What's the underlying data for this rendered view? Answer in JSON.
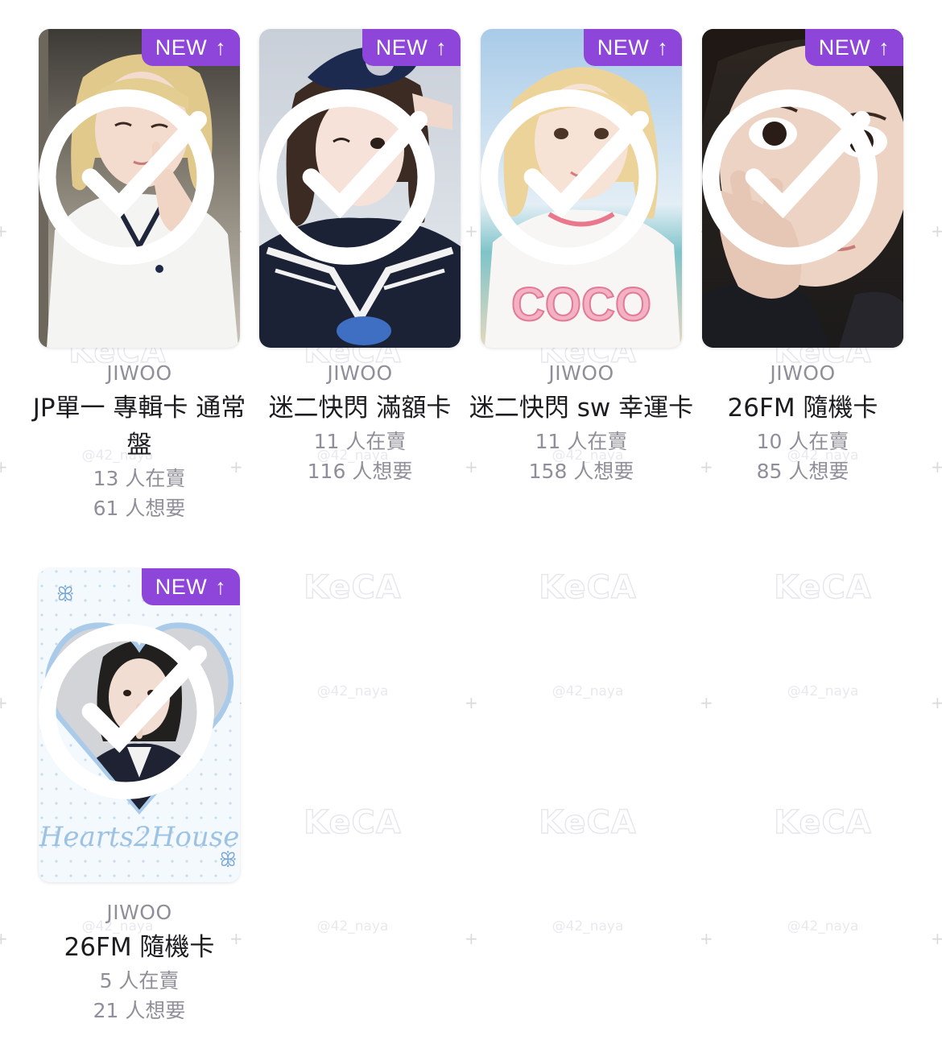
{
  "watermark": {
    "logo": "KeCA",
    "handle": "@42_naya"
  },
  "colors": {
    "badge": "#8d46d9",
    "artist_text": "#8f8f99",
    "name_text": "#1c1c1f"
  },
  "cards": [
    {
      "badge": "NEW",
      "badge_icon": "arrow-up-icon",
      "artist": "JIWOO",
      "name": "JP單一 專輯卡 通常盤",
      "sellers": "13 人在賣",
      "wanted": "61 人想要"
    },
    {
      "badge": "NEW",
      "badge_icon": "arrow-up-icon",
      "artist": "JIWOO",
      "name": "迷二快閃 滿額卡",
      "sellers": "11 人在賣",
      "wanted": "116 人想要"
    },
    {
      "badge": "NEW",
      "badge_icon": "arrow-up-icon",
      "artist": "JIWOO",
      "name": "迷二快閃 sw 幸運卡",
      "sellers": "11 人在賣",
      "wanted": "158 人想要"
    },
    {
      "badge": "NEW",
      "badge_icon": "arrow-up-icon",
      "artist": "JIWOO",
      "name": "26FM 隨機卡",
      "sellers": "10 人在賣",
      "wanted": "85 人想要"
    },
    {
      "badge": "NEW",
      "badge_icon": "arrow-up-icon",
      "artist": "JIWOO",
      "name": "26FM 隨機卡",
      "sellers": "5 人在賣",
      "wanted": "21 人想要",
      "card_art_text": "Hearts2House"
    }
  ]
}
